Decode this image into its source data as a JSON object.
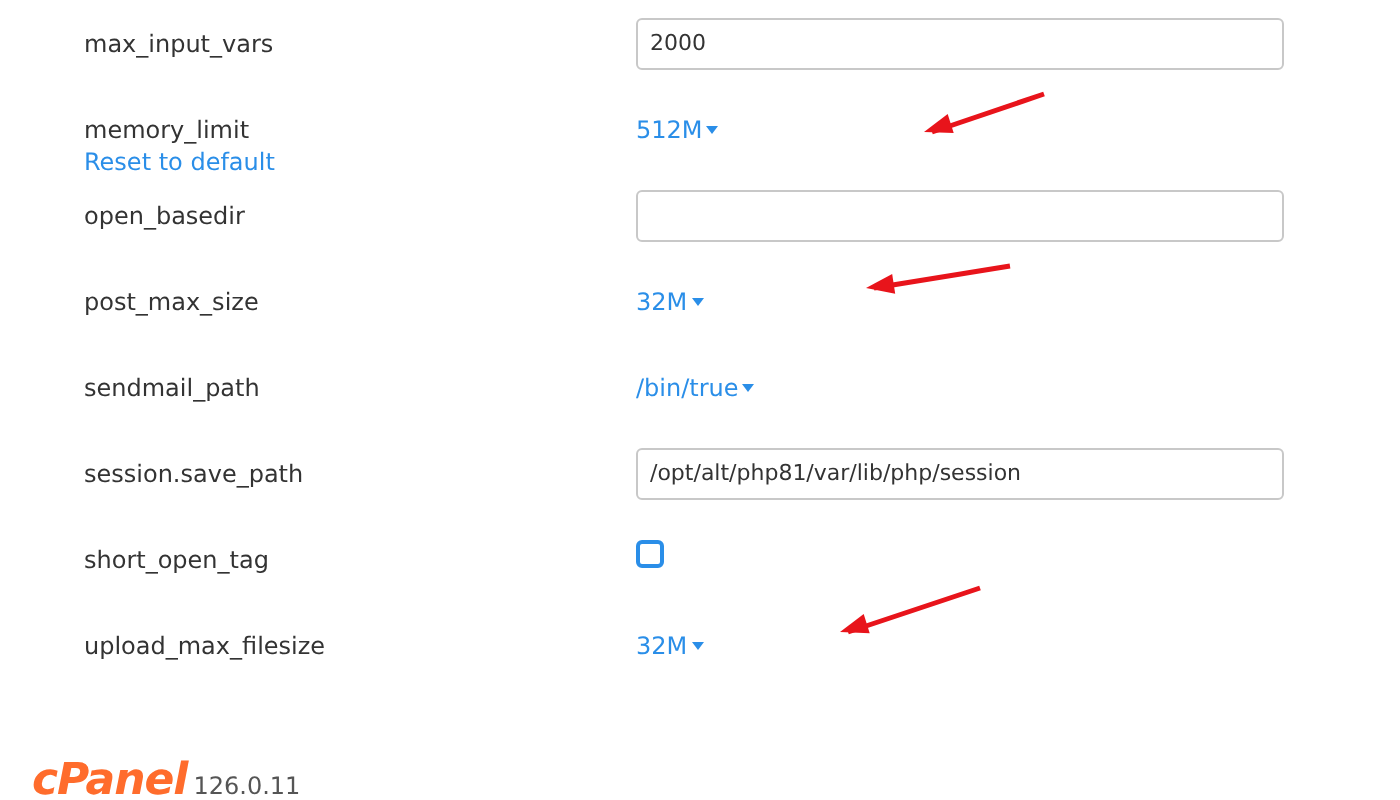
{
  "settings": [
    {
      "name": "max_input_vars",
      "kind": "text",
      "value": "2000"
    },
    {
      "name": "memory_limit",
      "kind": "select",
      "value": "512M",
      "reset_link": "Reset to default",
      "arrow": true
    },
    {
      "name": "open_basedir",
      "kind": "text"
    },
    {
      "name": "post_max_size",
      "kind": "select",
      "value": "32M",
      "arrow": true
    },
    {
      "name": "sendmail_path",
      "kind": "select",
      "value": "/bin/true"
    },
    {
      "name": "session.save_path",
      "kind": "text",
      "value": "/opt/alt/php81/var/lib/php/session"
    },
    {
      "name": "short_open_tag",
      "kind": "checkbox",
      "checked": false
    },
    {
      "name": "upload_max_filesize",
      "kind": "select",
      "value": "32M",
      "arrow": true
    }
  ],
  "footer": {
    "logo": "cPanel",
    "version": "126.0.11"
  }
}
